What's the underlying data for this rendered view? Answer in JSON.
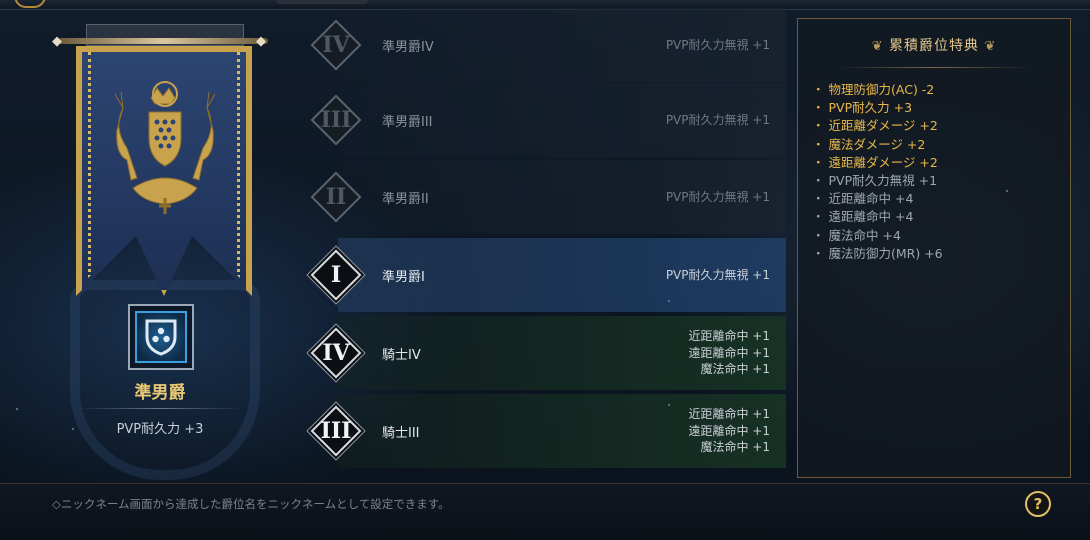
{
  "rank": {
    "name": "準男爵",
    "bonus": "PVP耐久力 +3"
  },
  "tiers": [
    {
      "numeral": "IV",
      "name": "準男爵IV",
      "state": "dim",
      "effects": [
        "PVP耐久力無視 +1"
      ]
    },
    {
      "numeral": "III",
      "name": "準男爵III",
      "state": "dim",
      "effects": [
        "PVP耐久力無視 +1"
      ]
    },
    {
      "numeral": "II",
      "name": "準男爵II",
      "state": "dim",
      "effects": [
        "PVP耐久力無視 +1"
      ]
    },
    {
      "numeral": "I",
      "name": "準男爵I",
      "state": "cur",
      "effects": [
        "PVP耐久力無視 +1"
      ]
    },
    {
      "numeral": "IV",
      "name": "騎士IV",
      "state": "knight",
      "effects": [
        "近距離命中 +1",
        "遠距離命中 +1",
        "魔法命中 +1"
      ]
    },
    {
      "numeral": "III",
      "name": "騎士III",
      "state": "knight",
      "effects": [
        "近距離命中 +1",
        "遠距離命中 +1",
        "魔法命中 +1"
      ]
    }
  ],
  "perks": {
    "title": "累積爵位特典",
    "items": [
      {
        "text": "物理防御力(AC) -2",
        "highlight": true
      },
      {
        "text": "PVP耐久力 +3",
        "highlight": true
      },
      {
        "text": "近距離ダメージ +2",
        "highlight": true
      },
      {
        "text": "魔法ダメージ +2",
        "highlight": true
      },
      {
        "text": "遠距離ダメージ +2",
        "highlight": true
      },
      {
        "text": "PVP耐久力無視 +1",
        "highlight": false
      },
      {
        "text": "近距離命中 +4",
        "highlight": false
      },
      {
        "text": "遠距離命中 +4",
        "highlight": false
      },
      {
        "text": "魔法命中 +4",
        "highlight": false
      },
      {
        "text": "魔法防御力(MR) +6",
        "highlight": false
      }
    ]
  },
  "footer": {
    "note": "◇ニックネーム画面から達成した爵位名をニックネームとして設定できます。",
    "help_label": "?"
  },
  "colors": {
    "gold": "#e8b84a",
    "accent_blue": "#3aa0e0",
    "banner_blue": "#2d4572"
  }
}
